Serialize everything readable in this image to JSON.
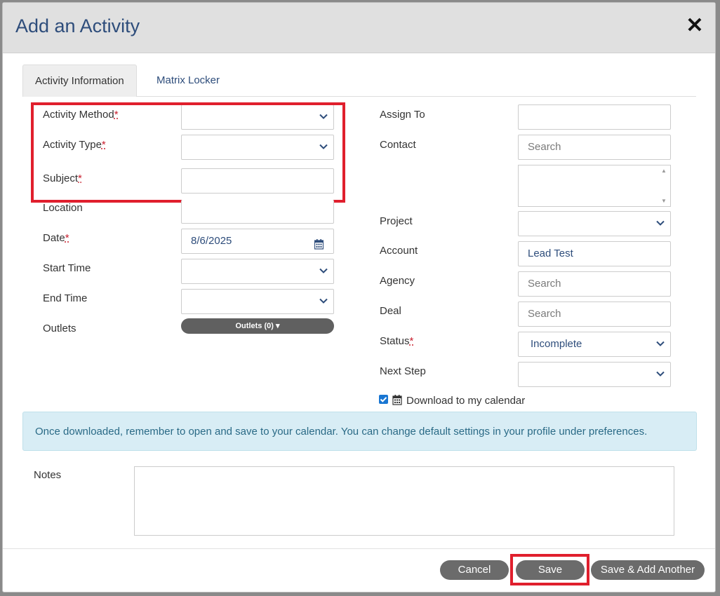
{
  "modal": {
    "title": "Add an Activity"
  },
  "tabs": [
    {
      "label": "Activity Information",
      "active": true
    },
    {
      "label": "Matrix Locker",
      "active": false
    }
  ],
  "left_fields": {
    "activity_method": {
      "label": "Activity Method",
      "required": true,
      "value": ""
    },
    "activity_type": {
      "label": "Activity Type",
      "required": true,
      "value": ""
    },
    "subject": {
      "label": "Subject",
      "required": true,
      "value": ""
    },
    "location": {
      "label": "Location",
      "value": ""
    },
    "date": {
      "label": "Date",
      "required": true,
      "value": "8/6/2025"
    },
    "start_time": {
      "label": "Start Time",
      "value": ""
    },
    "end_time": {
      "label": "End Time",
      "value": ""
    },
    "outlets": {
      "label": "Outlets",
      "button_label": "Outlets (0)"
    }
  },
  "right_fields": {
    "assign_to": {
      "label": "Assign To",
      "value": ""
    },
    "contact": {
      "label": "Contact",
      "placeholder": "Search"
    },
    "project": {
      "label": "Project",
      "value": ""
    },
    "account": {
      "label": "Account",
      "value": "Lead Test"
    },
    "agency": {
      "label": "Agency",
      "placeholder": "Search"
    },
    "deal": {
      "label": "Deal",
      "placeholder": "Search"
    },
    "status": {
      "label": "Status",
      "required": true,
      "value": "Incomplete"
    },
    "next_step": {
      "label": "Next Step",
      "value": ""
    }
  },
  "calendar": {
    "checkbox_label": "Download to my calendar",
    "checked": true
  },
  "info_banner": "Once downloaded, remember to open and save to your calendar. You can change default settings in your profile under preferences.",
  "notes": {
    "label": "Notes",
    "value": ""
  },
  "footer": {
    "cancel_label": "Cancel",
    "save_label": "Save",
    "save_add_label": "Save & Add Another"
  },
  "colors": {
    "required_star": "#c8202f",
    "highlight_box": "#e01f2d",
    "title": "#2e4d7b",
    "banner_bg": "#d8edf5",
    "button_bg": "#6b6b6b"
  },
  "icons": [
    "close-icon",
    "chevron-down-icon",
    "calendar-icon",
    "caret-down-icon",
    "checkbox-checked-icon"
  ]
}
